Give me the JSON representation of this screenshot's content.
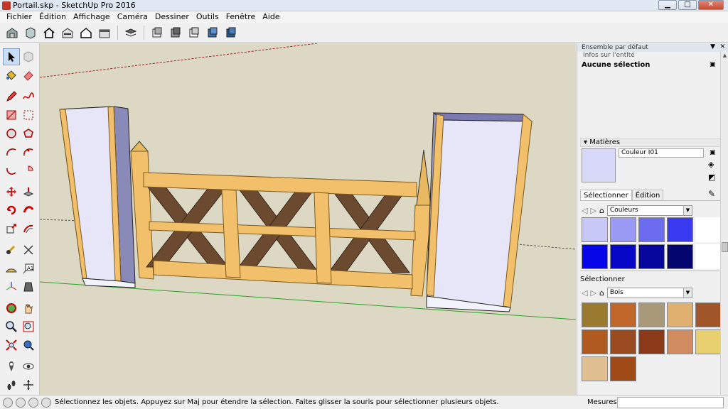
{
  "window": {
    "title": "Portail.skp - SketchUp Pro 2016",
    "minimize": "▁",
    "maximize": "□",
    "close": "✕"
  },
  "menu": [
    "Fichier",
    "Édition",
    "Affichage",
    "Caméra",
    "Dessiner",
    "Outils",
    "Fenêtre",
    "Aide"
  ],
  "toolbar": {
    "icons": [
      "warehouse-icon",
      "component-icon",
      "home-icon",
      "home-alt-icon",
      "house-outline-icon",
      "storage-icon",
      "layers-icon",
      "xray-style-icon",
      "backedges-style-icon",
      "hidden-line-style-icon",
      "shaded-style-icon",
      "textured-style-icon"
    ]
  },
  "left_tools": [
    "select",
    "eraser",
    "paint",
    "component",
    "pencil",
    "freehand",
    "rectangle",
    "rotated-rectangle",
    "circle",
    "polygon",
    "arc",
    "pie",
    "two-point-arc",
    "three-point-arc",
    "move",
    "push-pull",
    "rotate",
    "follow-me",
    "scale",
    "offset",
    "tape-measure",
    "dimension",
    "protractor",
    "text",
    "axes",
    "3d-text",
    "orbit",
    "pan",
    "zoom",
    "zoom-window",
    "zoom-extents",
    "previous-view",
    "position-camera",
    "look-around",
    "walk",
    "section-plane"
  ],
  "panel": {
    "header": "Ensemble par défaut",
    "entity_section": "Infos sur l'entité",
    "entity_status": "Aucune sélection",
    "materials_title": "Matières",
    "material_name": "Couleur I01",
    "tab_select": "Sélectionner",
    "tab_edit": "Édition",
    "library1": "Couleurs",
    "color_swatches": [
      "#c8c8f8",
      "#9a9af4",
      "#6c6cf0",
      "#3a3af0",
      "#ffffff",
      "#0505e8",
      "#0707c8",
      "#06069c",
      "#050570",
      "#ffffff"
    ],
    "select2_title": "Sélectionner",
    "library2": "Bois",
    "wood_swatches": [
      "#9a7a2e",
      "#c0662a",
      "#a89a78",
      "#e0b070",
      "#a0552a",
      "#b05a20",
      "#9a4a20",
      "#8a3a18",
      "#d08c60",
      "#e8d070",
      "#e0c090",
      "#a04a18"
    ]
  },
  "status": {
    "message": "Sélectionnez les objets. Appuyez sur Maj pour étendre la sélection. Faites glisser la souris pour sélectionner plusieurs objets.",
    "measure_label": "Mesures",
    "measure_value": ""
  },
  "colors": {
    "sky": "#dcd8c3",
    "wood_light": "#f2c06a",
    "wood_dark": "#6b4a30",
    "pillar_face": "#e6e6f8"
  }
}
